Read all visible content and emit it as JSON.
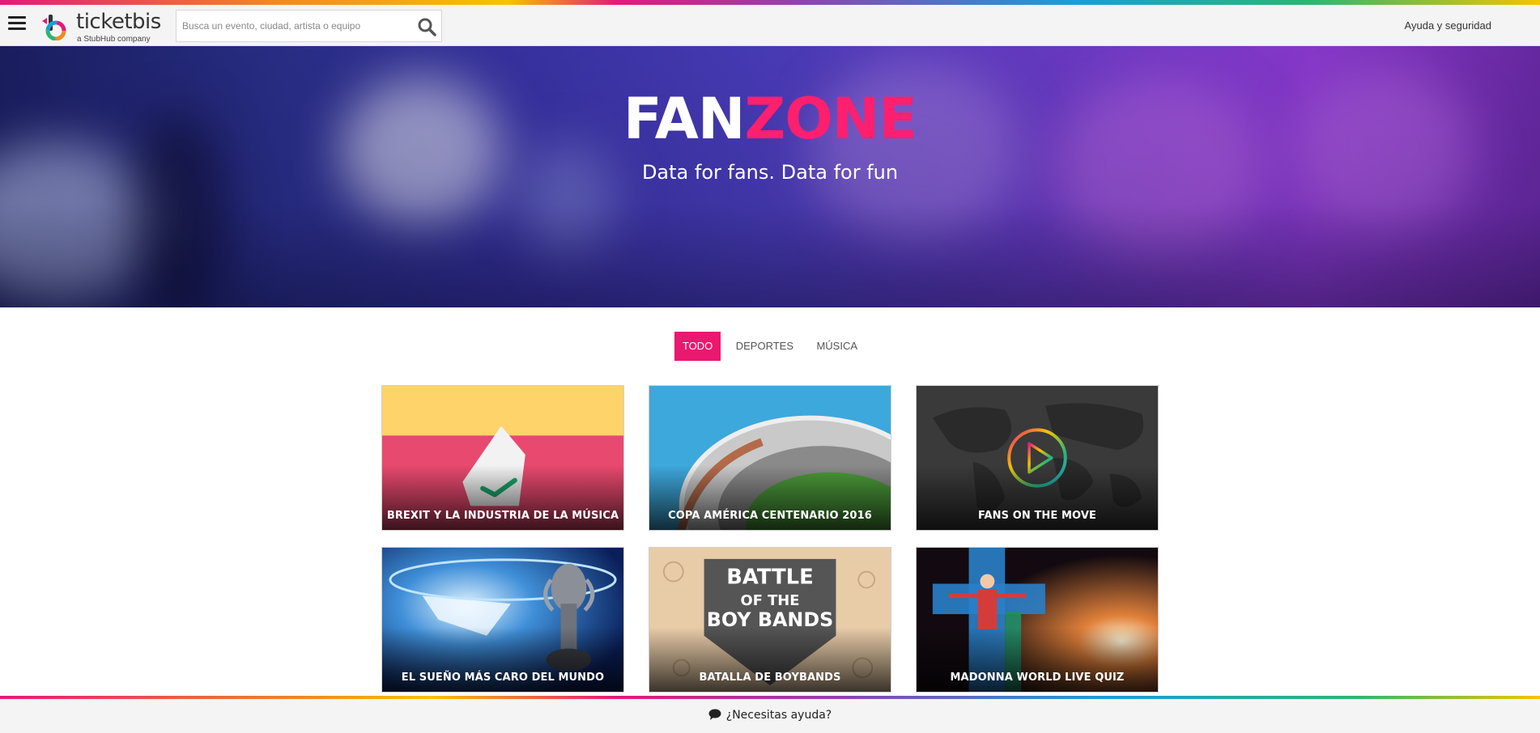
{
  "header": {
    "brand_name": "ticketbis",
    "brand_sub": "a StubHub company",
    "search_placeholder": "Busca un evento, ciudad, artista o equipo",
    "help_link": "Ayuda y seguridad"
  },
  "hero": {
    "title_part1": "FAN",
    "title_part2": "ZONE",
    "subtitle": "Data for fans. Data for fun"
  },
  "filters": [
    {
      "label": "TODO",
      "active": true
    },
    {
      "label": "DEPORTES",
      "active": false
    },
    {
      "label": "MÚSICA",
      "active": false
    }
  ],
  "cards": [
    {
      "title": "BREXIT Y LA INDUSTRIA DE LA MÚSICA",
      "icon": "ballot-box-icon"
    },
    {
      "title": "COPA AMÉRICA CENTENARIO 2016",
      "icon": "stadium-icon"
    },
    {
      "title": "FANS ON THE MOVE",
      "icon": "play-icon"
    },
    {
      "title": "EL SUEÑO MÁS CARO DEL MUNDO",
      "icon": "trophy-icon"
    },
    {
      "title": "BATALLA DE BOYBANDS",
      "icon": "shield-icon"
    },
    {
      "title": "MADONNA WORLD LIVE QUIZ",
      "icon": "cross-icon"
    }
  ],
  "boyband_badge": {
    "line1": "BATTLE",
    "line2": "OF THE",
    "line3": "BOY BANDS"
  },
  "footer": {
    "help_text": "¿Necesitas ayuda?"
  },
  "colors": {
    "accent": "#e8196f",
    "zone": "#ff1f6f"
  }
}
